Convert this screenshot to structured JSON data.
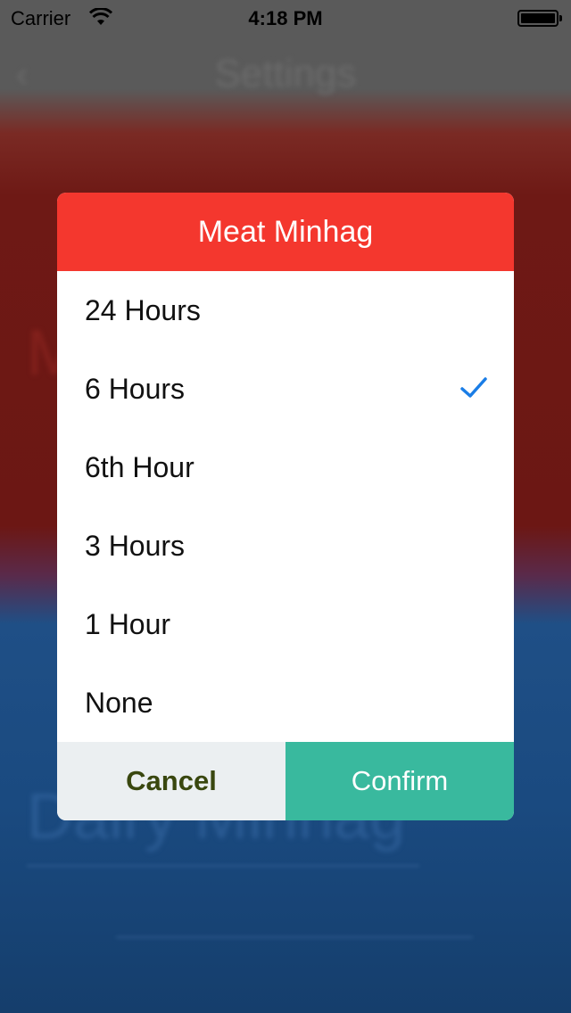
{
  "status_bar": {
    "carrier": "Carrier",
    "time": "4:18 PM"
  },
  "background": {
    "nav_title": "Settings",
    "back_icon": "chevron-left-icon",
    "section_meat": "M",
    "section_dairy": "Dairy Minhag"
  },
  "dialog": {
    "title": "Meat Minhag",
    "options": [
      {
        "label": "24 Hours",
        "selected": false
      },
      {
        "label": "6 Hours",
        "selected": true
      },
      {
        "label": "6th Hour",
        "selected": false
      },
      {
        "label": "3 Hours",
        "selected": false
      },
      {
        "label": "1 Hour",
        "selected": false
      },
      {
        "label": "None",
        "selected": false
      }
    ],
    "cancel_label": "Cancel",
    "confirm_label": "Confirm"
  },
  "colors": {
    "header": "#f4372e",
    "check": "#1a7de6",
    "cancel_bg": "#ebeff1",
    "cancel_text": "#39470f",
    "confirm_bg": "#39b99e"
  }
}
